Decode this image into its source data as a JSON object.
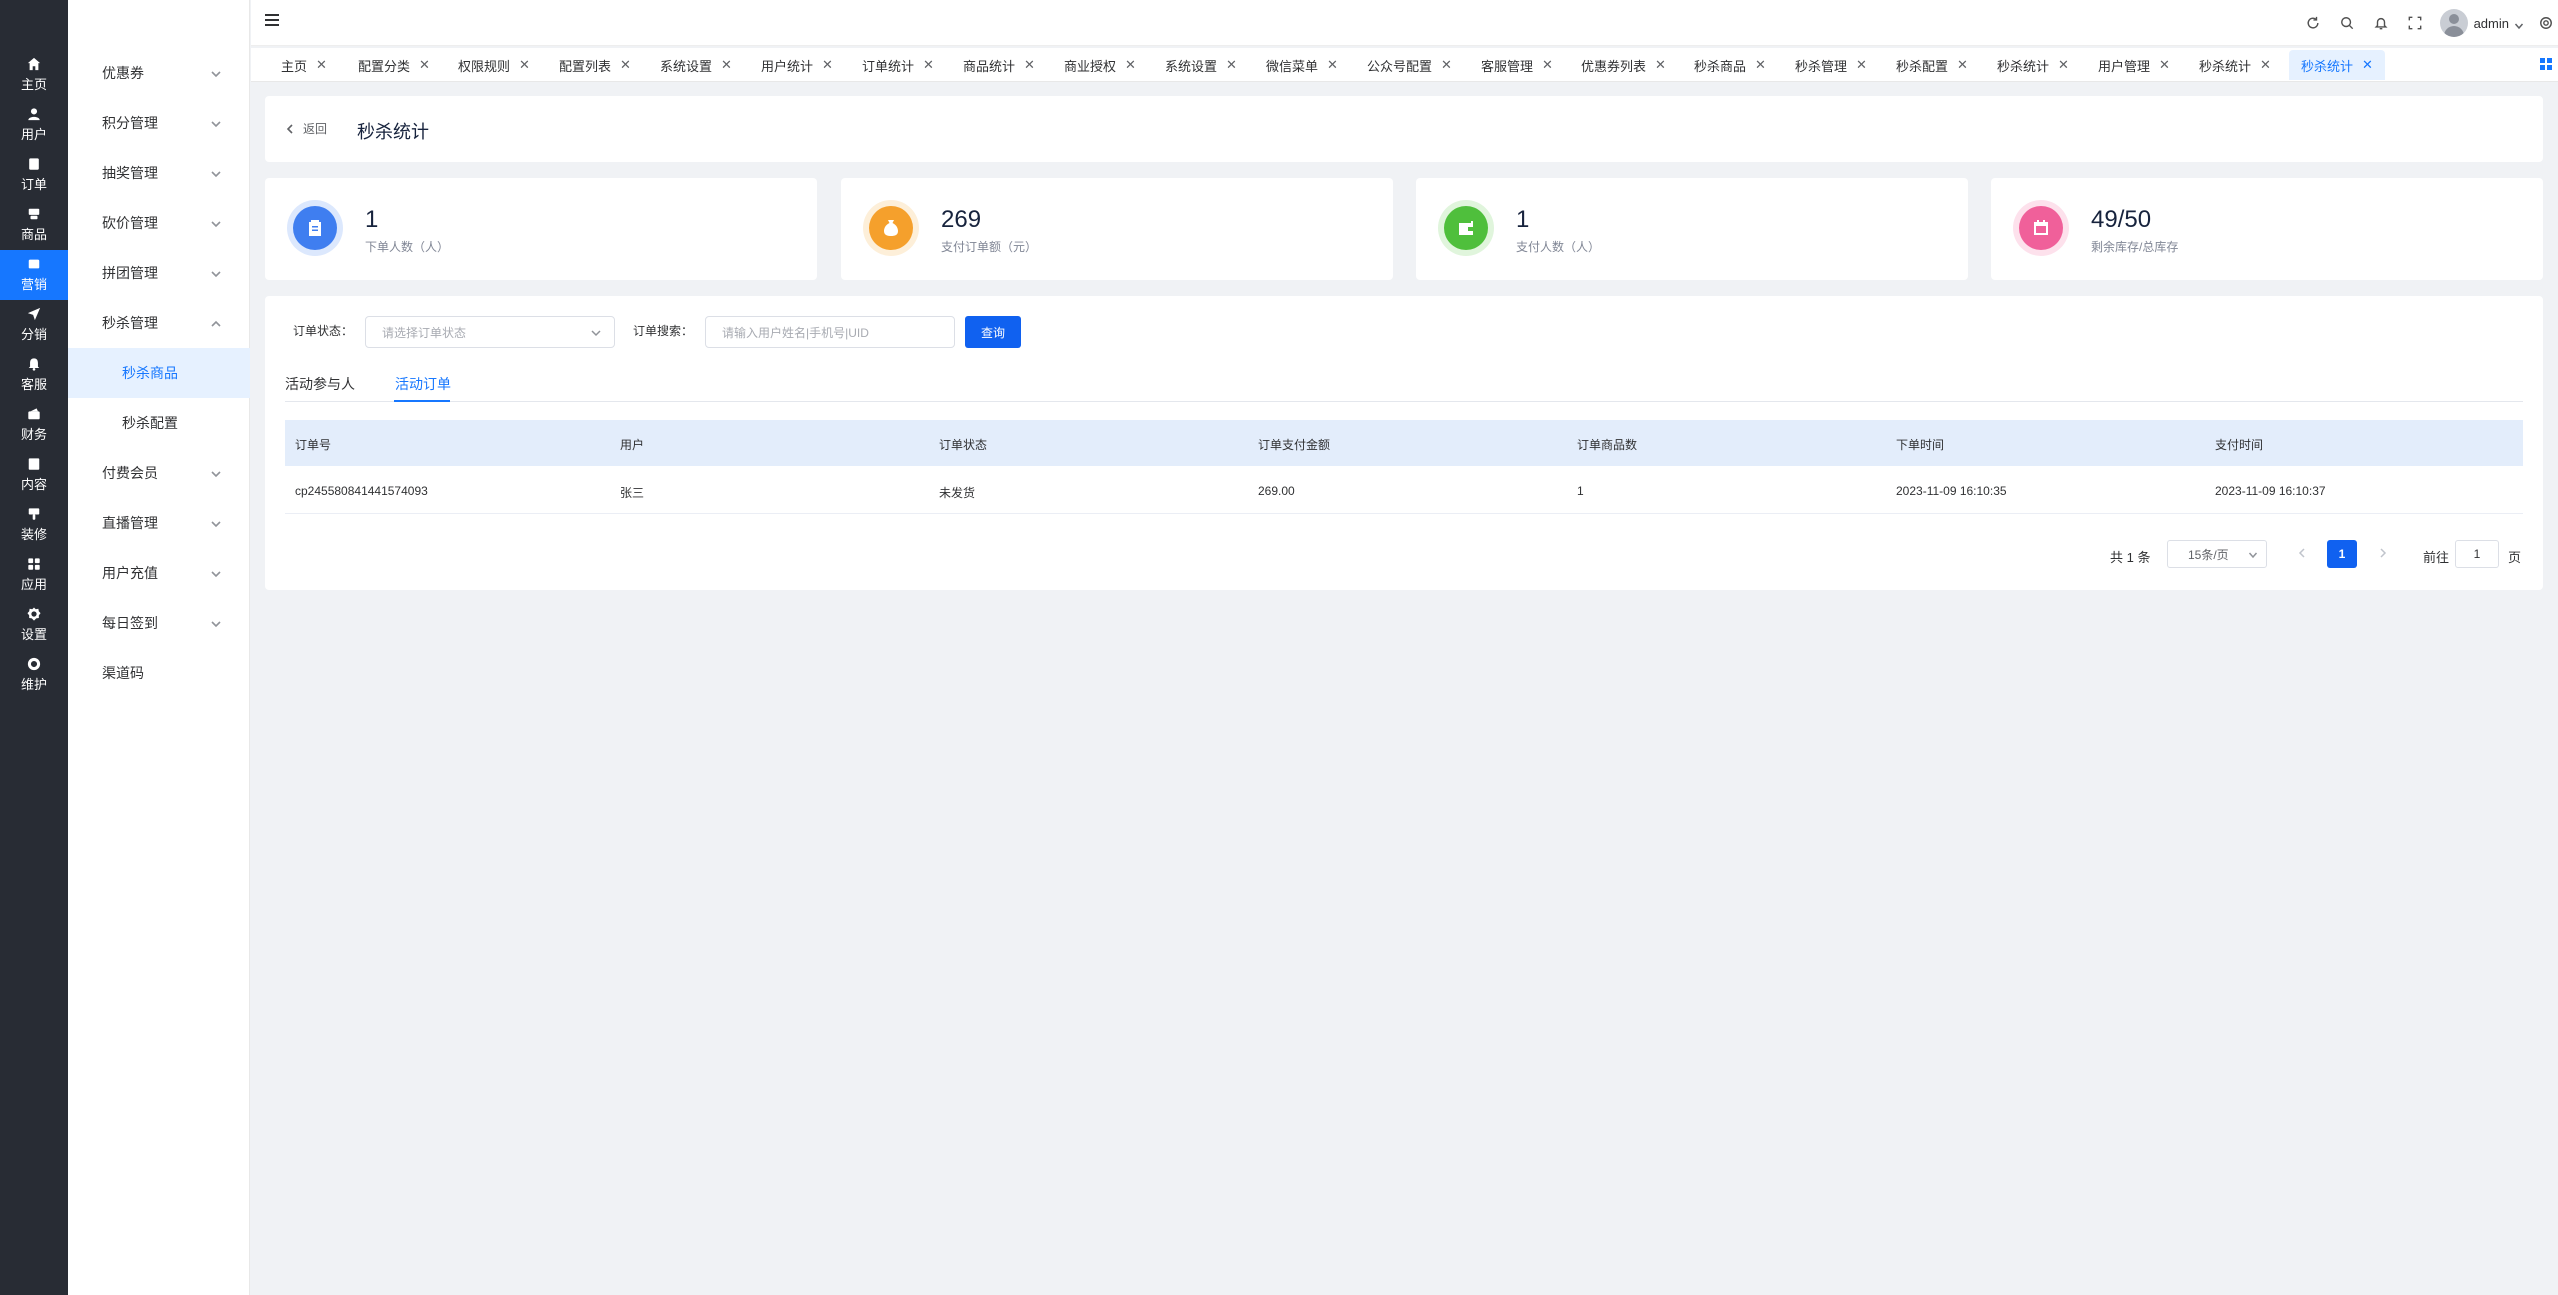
{
  "rail": [
    {
      "label": "主页",
      "icon": "home-icon"
    },
    {
      "label": "用户",
      "icon": "user-icon"
    },
    {
      "label": "订单",
      "icon": "order-icon"
    },
    {
      "label": "商品",
      "icon": "goods-icon"
    },
    {
      "label": "营销",
      "icon": "marketing-icon",
      "active": true
    },
    {
      "label": "分销",
      "icon": "distribution-icon"
    },
    {
      "label": "客服",
      "icon": "service-icon"
    },
    {
      "label": "财务",
      "icon": "finance-icon"
    },
    {
      "label": "内容",
      "icon": "content-icon"
    },
    {
      "label": "装修",
      "icon": "decorate-icon"
    },
    {
      "label": "应用",
      "icon": "apps-icon"
    },
    {
      "label": "设置",
      "icon": "settings-icon"
    },
    {
      "label": "维护",
      "icon": "maintain-icon"
    }
  ],
  "submenu": {
    "items": [
      "优惠券",
      "积分管理",
      "抽奖管理",
      "砍价管理",
      "拼团管理",
      "秒杀管理",
      "秒杀商品",
      "秒杀配置",
      "付费会员",
      "直播管理",
      "用户充值",
      "每日签到",
      "渠道码"
    ]
  },
  "header": {
    "username": "admin"
  },
  "tags": [
    "主页",
    "配置分类",
    "权限规则",
    "配置列表",
    "系统设置",
    "用户统计",
    "订单统计",
    "商品统计",
    "商业授权",
    "系统设置",
    "微信菜单",
    "公众号配置",
    "客服管理",
    "优惠券列表",
    "秒杀商品",
    "秒杀管理",
    "秒杀配置",
    "秒杀统计",
    "用户管理",
    "秒杀统计",
    "秒杀统计"
  ],
  "page": {
    "back_label": "返回",
    "title": "秒杀统计"
  },
  "stats": [
    {
      "value": "1",
      "label": "下单人数（人）",
      "color": "#3f7ef0",
      "ring": "#dce8fd",
      "icon": "clipboard-icon"
    },
    {
      "value": "269",
      "label": "支付订单额（元）",
      "color": "#f5a02c",
      "ring": "#fdefd9",
      "icon": "money-bag-icon"
    },
    {
      "value": "1",
      "label": "支付人数（人）",
      "color": "#4fbf3c",
      "ring": "#e0f5dc",
      "icon": "wallet-icon"
    },
    {
      "value": "49/50",
      "label": "剩余库存/总库存",
      "color": "#f0609a",
      "ring": "#fde1ec",
      "icon": "calendar-icon"
    }
  ],
  "filters": {
    "status_label": "订单状态：",
    "status_placeholder": "请选择订单状态",
    "search_label": "订单搜索：",
    "search_placeholder": "请输入用户姓名|手机号|UID",
    "query_button": "查询"
  },
  "tabs": [
    "活动参与人",
    "活动订单"
  ],
  "table": {
    "columns": [
      "订单号",
      "用户",
      "订单状态",
      "订单支付金额",
      "订单商品数",
      "下单时间",
      "支付时间"
    ],
    "rows": [
      [
        "cp245580841441574093",
        "张三",
        "未发货",
        "269.00",
        "1",
        "2023-11-09 16:10:35",
        "2023-11-09 16:10:37"
      ]
    ]
  },
  "pagination": {
    "total": "共 1 条",
    "page_size": "15条/页",
    "current": "1",
    "goto_label": "前往",
    "goto_value": "1",
    "page_suffix": "页"
  },
  "colors": {
    "accent": "#1677ff",
    "rail_bg": "#282c34"
  }
}
